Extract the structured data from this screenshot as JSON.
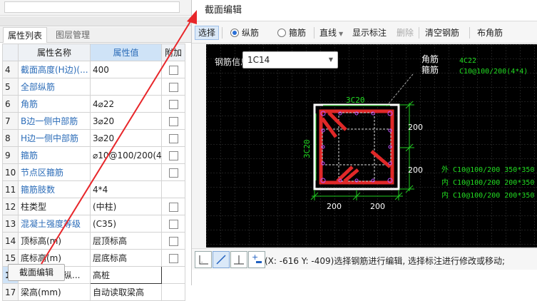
{
  "left_panel": {
    "tabs": [
      "属性列表",
      "图层管理"
    ],
    "headers": {
      "name": "属性名称",
      "value": "属性值",
      "add": "附加"
    },
    "rows": [
      {
        "n": "4",
        "name": "截面高度(H边)(...",
        "value": "400",
        "blue": true,
        "chk": true
      },
      {
        "n": "5",
        "name": "全部纵筋",
        "value": "",
        "blue": true,
        "chk": true
      },
      {
        "n": "6",
        "name": "角筋",
        "value": "4⌀22",
        "blue": true,
        "chk": true
      },
      {
        "n": "7",
        "name": "B边一侧中部筋",
        "value": "3⌀20",
        "blue": true,
        "chk": true
      },
      {
        "n": "8",
        "name": "H边一侧中部筋",
        "value": "3⌀20",
        "blue": true,
        "chk": true
      },
      {
        "n": "9",
        "name": "箍筋",
        "value": "⌀10@100/200(4",
        "blue": true,
        "chk": true
      },
      {
        "n": "10",
        "name": "节点区箍筋",
        "value": "",
        "blue": true,
        "chk": true
      },
      {
        "n": "11",
        "name": "箍筋肢数",
        "value": "4*4",
        "blue": true,
        "chk": false
      },
      {
        "n": "12",
        "name": "柱类型",
        "value": "(中柱)",
        "blue": false,
        "chk": true
      },
      {
        "n": "13",
        "name": "混凝土强度等级",
        "value": "(C35)",
        "blue": true,
        "chk": true
      },
      {
        "n": "14",
        "name": "顶标高(m)",
        "value": "层顶标高",
        "blue": false,
        "chk": true
      },
      {
        "n": "15",
        "name": "底标高(m)",
        "value": "层底标高",
        "blue": false,
        "chk": true
      },
      {
        "n": "16",
        "name": "左下角起始纵...",
        "value": "高桩",
        "blue": false,
        "chk": false,
        "selected": true
      },
      {
        "n": "17",
        "name": "梁高(mm)",
        "value": "自动读取梁高",
        "blue": false,
        "chk": false
      }
    ],
    "button": "截面编辑"
  },
  "dialog": {
    "title": "截面编辑",
    "toolbar": {
      "select": "选择",
      "longitudinal": "纵筋",
      "stirrup": "箍筋",
      "line": "直线",
      "show_label": "显示标注",
      "delete": "删除",
      "clear": "清空钢筋",
      "corner": "布角筋"
    },
    "rebar_info_label": "钢筋信息:",
    "rebar_info_value": "1C14",
    "canvas": {
      "legend_corner": "角筋",
      "legend_stirrup": "箍筋",
      "corner_spec": "4C22",
      "stirrup_spec": "C10@100/200(4*4)",
      "top_label": "3C20",
      "side_label": "3C20",
      "dim_right_1": "200",
      "dim_right_2": "200",
      "dim_bottom_1": "200",
      "dim_bottom_2": "200",
      "stirrup_lines": [
        "外 C10@100/200 350*350",
        "内 C10@100/200 200*350",
        "内 C10@100/200 200*350"
      ]
    },
    "status": "(X: -616 Y: -409)选择钢筋进行编辑, 选择标注进行修改或移动;"
  },
  "colors": {
    "rebar": "#e02828",
    "dimension": "#22cc22",
    "stirrup_text": "#22dd22",
    "section_outline": "#ffffff",
    "arrow": "#e8262a"
  }
}
